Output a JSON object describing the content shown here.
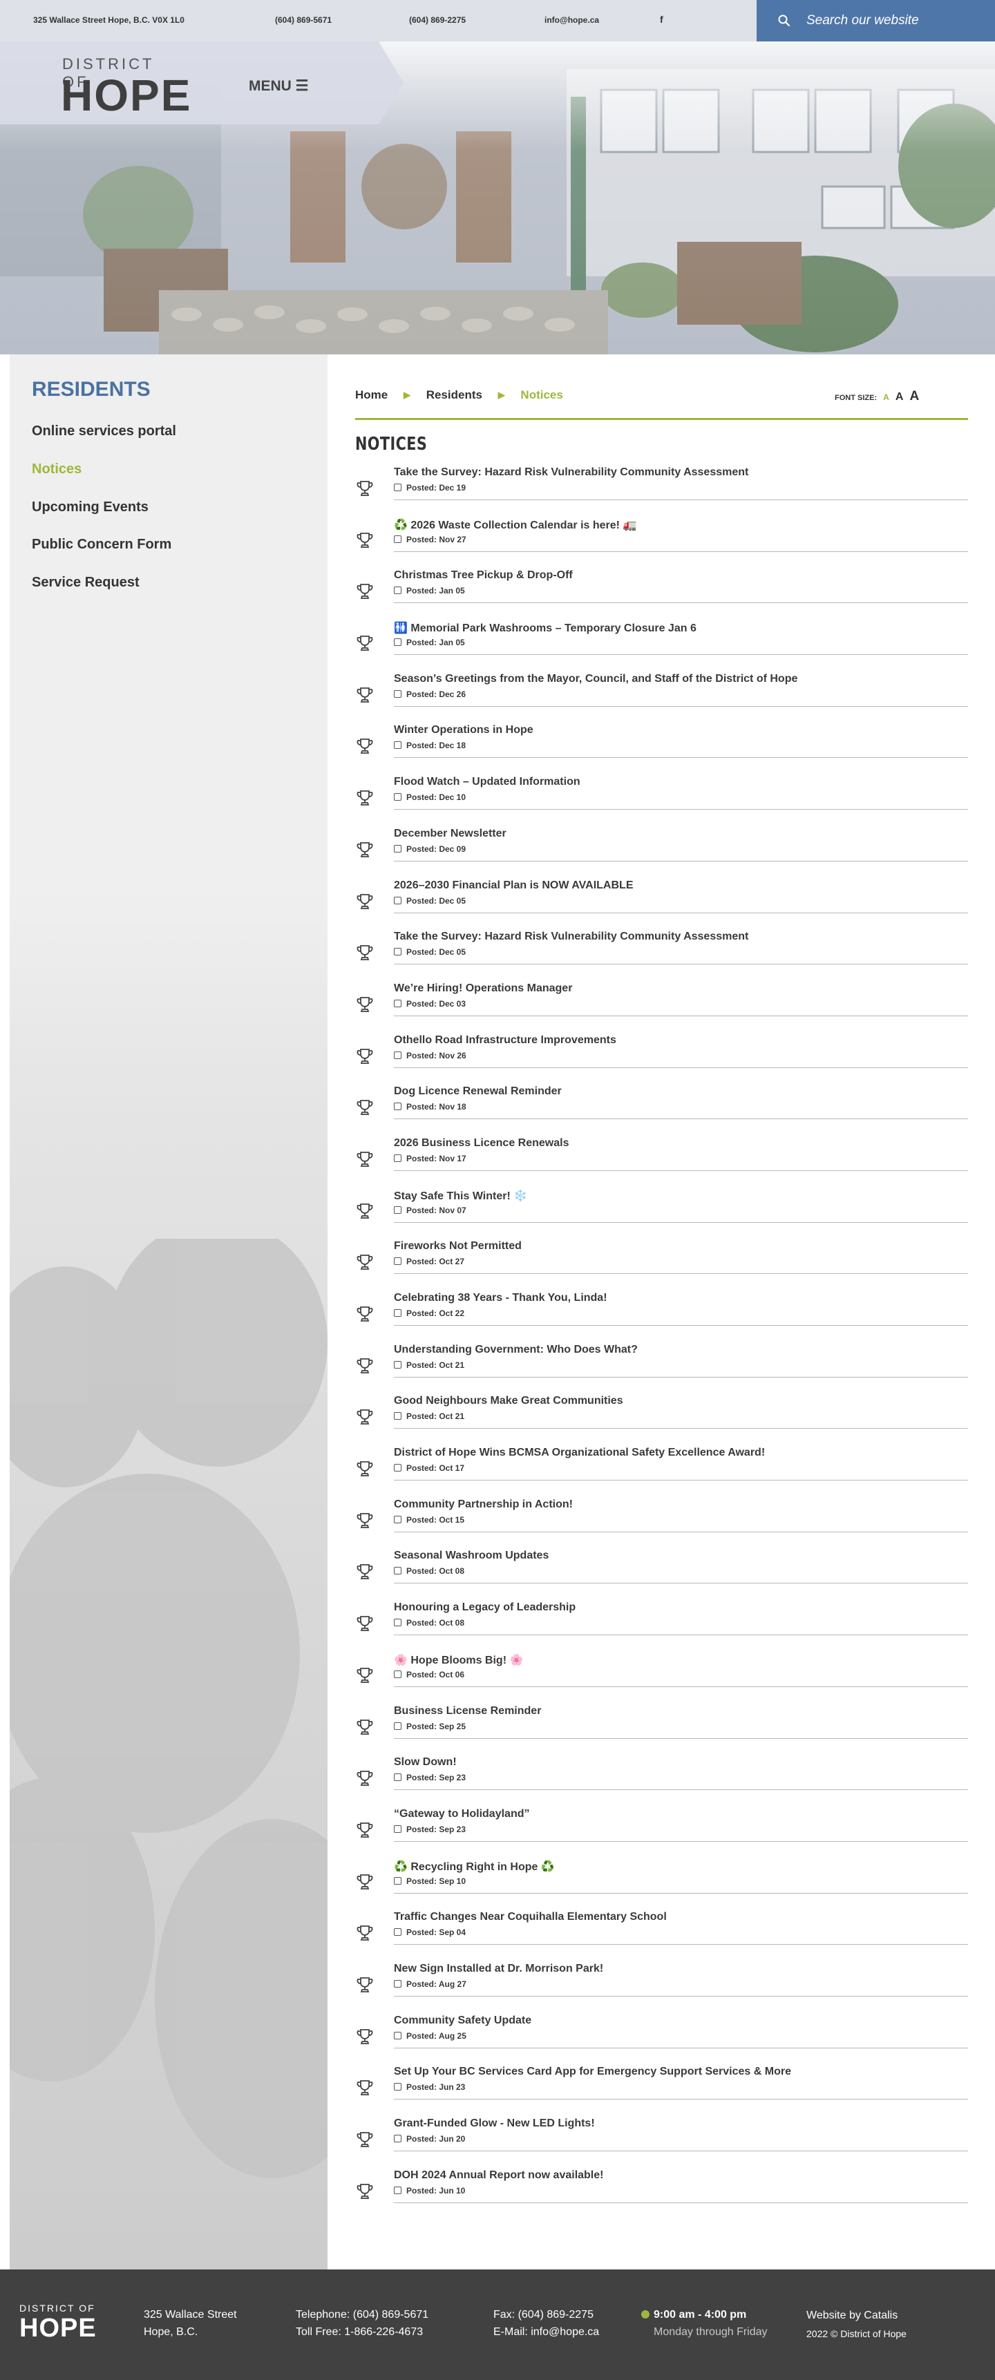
{
  "topbar": {
    "address": "325 Wallace Street Hope, B.C. V0X 1L0",
    "phone1": "(604) 869-5671",
    "phone2": "(604) 869-2275",
    "email": "info@hope.ca",
    "facebook_glyph": "f"
  },
  "search": {
    "placeholder": "Search our website",
    "icon": "search-icon"
  },
  "header": {
    "logo_top": "DISTRICT OF",
    "logo_bottom": "HOPE",
    "menu_label": "MENU ☰"
  },
  "sidebar": {
    "title": "RESIDENTS",
    "items": [
      {
        "label": "Online services portal",
        "active": false
      },
      {
        "label": "Notices",
        "active": true
      },
      {
        "label": "Upcoming Events",
        "active": false
      },
      {
        "label": "Public Concern Form",
        "active": false
      },
      {
        "label": "Service Request",
        "active": false
      }
    ]
  },
  "breadcrumb": {
    "home": "Home",
    "section": "Residents",
    "current": "Notices",
    "sep": "▶"
  },
  "font_size": {
    "label": "FONT SIZE:",
    "small": "A",
    "medium": "A",
    "large": "A"
  },
  "page": {
    "title": "NOTICES"
  },
  "notices": [
    {
      "title": "Take the Survey: Hazard Risk Vulnerability Community Assessment",
      "posted": "Posted: Dec 19"
    },
    {
      "title": "♻️ 2026 Waste Collection Calendar is here! 🚛",
      "posted": "Posted: Nov 27"
    },
    {
      "title": "Christmas Tree Pickup & Drop-Off",
      "posted": "Posted: Jan 05"
    },
    {
      "title": "🚻 Memorial Park Washrooms – Temporary Closure Jan 6",
      "posted": "Posted: Jan 05"
    },
    {
      "title": "Season’s Greetings from the Mayor, Council, and Staff of the District of Hope",
      "posted": "Posted: Dec 26"
    },
    {
      "title": "Winter Operations in Hope",
      "posted": "Posted: Dec 18"
    },
    {
      "title": "Flood Watch – Updated Information",
      "posted": "Posted: Dec 10"
    },
    {
      "title": "December Newsletter",
      "posted": "Posted: Dec 09"
    },
    {
      "title": "2026–2030 Financial Plan is NOW AVAILABLE",
      "posted": "Posted: Dec 05"
    },
    {
      "title": "Take the Survey: Hazard Risk Vulnerability Community Assessment",
      "posted": "Posted: Dec 05"
    },
    {
      "title": "We’re Hiring! Operations Manager",
      "posted": "Posted: Dec 03"
    },
    {
      "title": "Othello Road Infrastructure Improvements",
      "posted": "Posted: Nov 26"
    },
    {
      "title": "Dog Licence Renewal Reminder",
      "posted": "Posted: Nov 18"
    },
    {
      "title": "2026 Business Licence Renewals",
      "posted": "Posted: Nov 17"
    },
    {
      "title": "Stay Safe This Winter! ❄️",
      "posted": "Posted: Nov 07"
    },
    {
      "title": "Fireworks Not Permitted",
      "posted": "Posted: Oct 27"
    },
    {
      "title": "Celebrating 38 Years - Thank You, Linda!",
      "posted": "Posted: Oct 22"
    },
    {
      "title": "Understanding Government: Who Does What?",
      "posted": "Posted: Oct 21"
    },
    {
      "title": "Good Neighbours Make Great Communities",
      "posted": "Posted: Oct 21"
    },
    {
      "title": "District of Hope Wins BCMSA Organizational Safety Excellence Award!",
      "posted": "Posted: Oct 17"
    },
    {
      "title": "Community Partnership in Action!",
      "posted": "Posted: Oct 15"
    },
    {
      "title": "Seasonal Washroom Updates",
      "posted": "Posted: Oct 08"
    },
    {
      "title": "Honouring a Legacy of Leadership",
      "posted": "Posted: Oct 08"
    },
    {
      "title": "🌸 Hope Blooms Big! 🌸",
      "posted": "Posted: Oct 06"
    },
    {
      "title": "Business License Reminder",
      "posted": "Posted: Sep 25"
    },
    {
      "title": "Slow Down!",
      "posted": "Posted: Sep 23"
    },
    {
      "title": "“Gateway to Holidayland”",
      "posted": "Posted: Sep 23"
    },
    {
      "title": "♻️ Recycling Right in Hope ♻️",
      "posted": "Posted: Sep 10"
    },
    {
      "title": "Traffic Changes Near Coquihalla Elementary School",
      "posted": "Posted: Sep 04"
    },
    {
      "title": "New Sign Installed at Dr. Morrison Park!",
      "posted": "Posted: Aug 27"
    },
    {
      "title": "Community Safety Update",
      "posted": "Posted: Aug 25"
    },
    {
      "title": "Set Up Your BC Services Card App for Emergency Support Services & More",
      "posted": "Posted: Jun 23"
    },
    {
      "title": "Grant-Funded Glow - New LED Lights!",
      "posted": "Posted: Jun 20"
    },
    {
      "title": "DOH 2024 Annual Report now available!",
      "posted": "Posted: Jun 10"
    }
  ],
  "footer": {
    "logo_top": "DISTRICT OF",
    "logo_bottom": "HOPE",
    "address_line1": "325 Wallace Street",
    "address_line2": "Hope, B.C.",
    "telephone": "Telephone: (604) 869-5671",
    "toll_free": "Toll Free: 1-866-226-4673",
    "fax": "Fax: (604) 869-2275",
    "email": "E-Mail: info@hope.ca",
    "hours": "9:00 am - 4:00 pm",
    "days": "Monday through Friday",
    "credit": "Website by Catalis",
    "copyright": "2022 © District of Hope"
  },
  "colors": {
    "accent_green": "#9cb83a",
    "brand_blue": "#4f76a8",
    "footer_bg": "#414141"
  }
}
